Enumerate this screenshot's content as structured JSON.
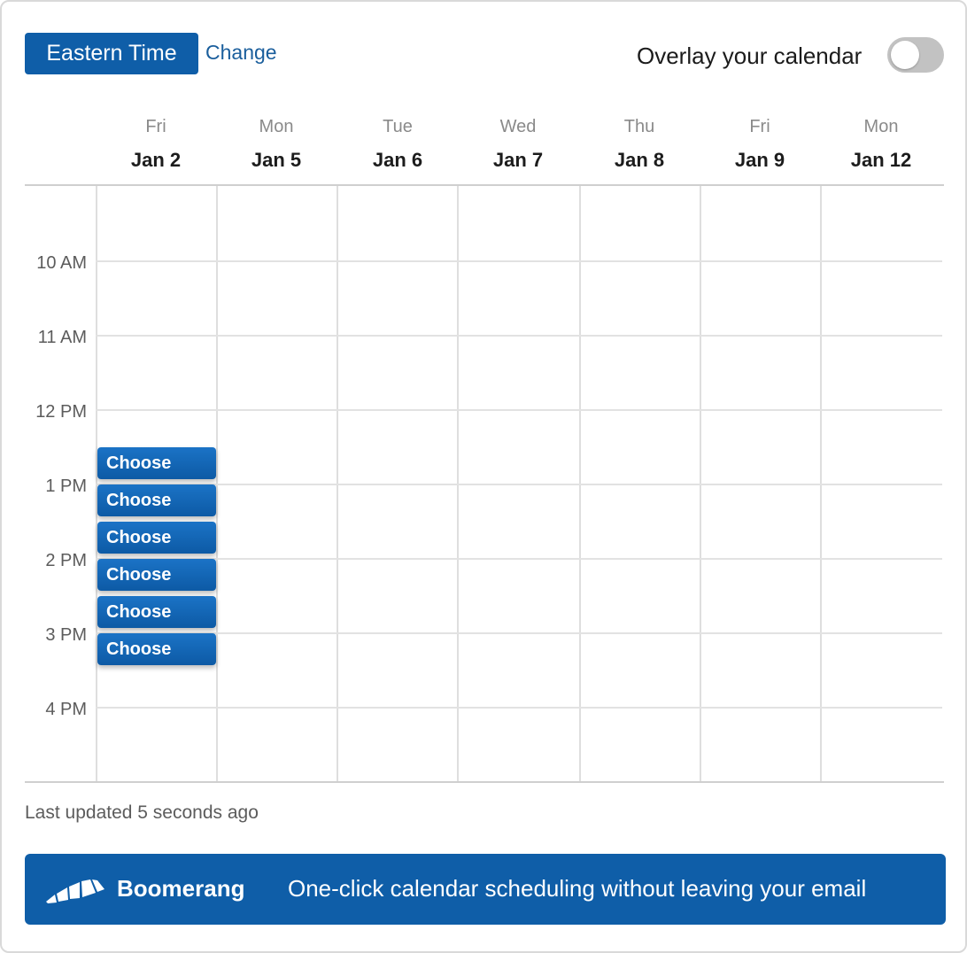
{
  "header": {
    "timezone_label": "Eastern Time",
    "change_label": "Change",
    "overlay_label": "Overlay your calendar",
    "overlay_enabled": false
  },
  "days": [
    {
      "dow": "Fri",
      "date": "Jan 2"
    },
    {
      "dow": "Mon",
      "date": "Jan 5"
    },
    {
      "dow": "Tue",
      "date": "Jan 6"
    },
    {
      "dow": "Wed",
      "date": "Jan 7"
    },
    {
      "dow": "Thu",
      "date": "Jan 8"
    },
    {
      "dow": "Fri",
      "date": "Jan 9"
    },
    {
      "dow": "Mon",
      "date": "Jan 12"
    }
  ],
  "times": [
    "10 AM",
    "11 AM",
    "12 PM",
    "1 PM",
    "2 PM",
    "3 PM",
    "4 PM"
  ],
  "slots": [
    {
      "label": "Choose"
    },
    {
      "label": "Choose"
    },
    {
      "label": "Choose"
    },
    {
      "label": "Choose"
    },
    {
      "label": "Choose"
    },
    {
      "label": "Choose"
    }
  ],
  "footer": {
    "last_updated": "Last updated 5 seconds ago",
    "brand": "Boomerang",
    "tagline": "One-click calendar scheduling without leaving your email"
  },
  "colors": {
    "accent": "#0f5ea8",
    "toggle_off": "#c2c2c2",
    "grid_line": "#e2e2e2"
  },
  "icons": {
    "logo": "boomerang-logo-icon"
  }
}
